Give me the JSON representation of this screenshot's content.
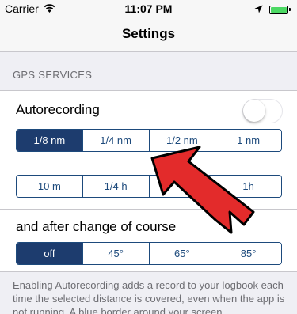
{
  "status_bar": {
    "carrier": "Carrier",
    "time": "11:07 PM",
    "battery_color": "#4cd964"
  },
  "nav": {
    "title": "Settings"
  },
  "section": {
    "header": "GPS SERVICES"
  },
  "autorecording": {
    "label": "Autorecording",
    "toggle_on": false,
    "distance_options": [
      "1/8 nm",
      "1/4 nm",
      "1/2 nm",
      "1 nm"
    ],
    "distance_selected": "1/8 nm",
    "time_options": [
      "10 m",
      "1/4 h",
      "",
      "1h"
    ],
    "time_selected": ""
  },
  "course_change": {
    "label": "and after change of course",
    "options": [
      "off",
      "45°",
      "65°",
      "85°"
    ],
    "selected": "off"
  },
  "footer": {
    "text": "Enabling Autorecording adds a record to your logbook each time the selected distance is covered, even when the app is not running. A blue border around your screen"
  },
  "colors": {
    "accent": "#1d3c6e",
    "arrow_fill": "#e32b2b",
    "arrow_outline": "#000000"
  },
  "icons": [
    "wifi-icon",
    "location-arrow-icon",
    "battery-icon",
    "red-arrow-annotation"
  ]
}
